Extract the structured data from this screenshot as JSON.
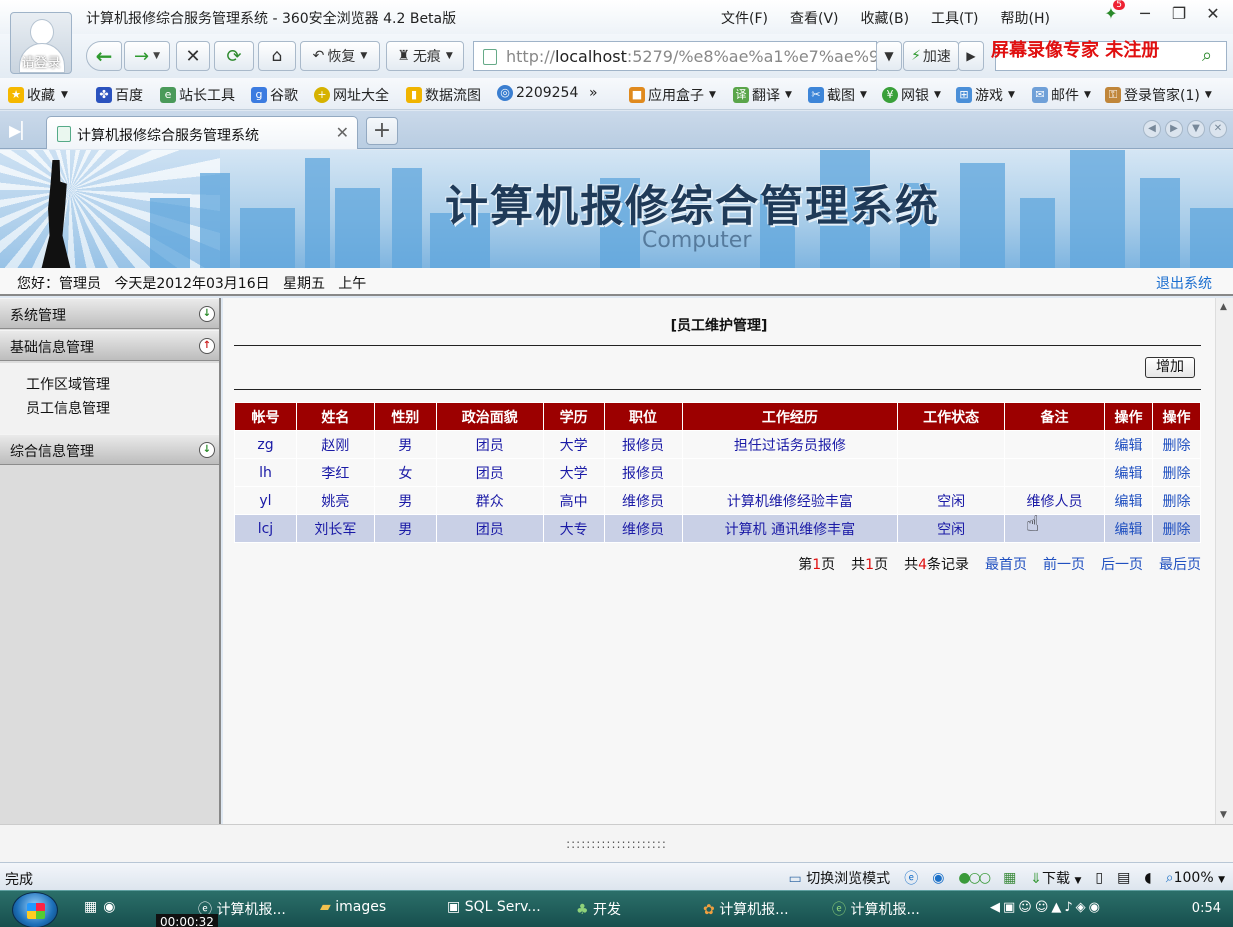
{
  "browser": {
    "window_title": "计算机报修综合服务管理系统 - 360安全浏览器 4.2 Beta版",
    "login_label": "请登录",
    "menus": [
      "文件(F)",
      "查看(V)",
      "收藏(B)",
      "工具(T)",
      "帮助(H)"
    ],
    "notif_count": "5",
    "restore_label": "恢复",
    "nohist_label": "无痕",
    "url_prefix": "http://",
    "url_host": "localhost",
    "url_rest": ":5279/%e8%ae%a1%e7%ae%9",
    "speed_label": "加速",
    "watermark": "屏幕录像专家 未注册",
    "favorites": [
      "收藏",
      "百度",
      "站长工具",
      "谷歌",
      "网址大全",
      "数据流图",
      "2209254",
      "»",
      "应用盒子",
      "翻译",
      "截图",
      "网银",
      "游戏",
      "邮件",
      "登录管家(1)"
    ],
    "tab_title": "计算机报修综合服务管理系统",
    "status_done": "完成",
    "status_mode": "切换浏览模式",
    "status_download": "下载",
    "zoom": "100%"
  },
  "banner": {
    "title": "计算机报修综合管理系统",
    "subtitle": "Computer"
  },
  "welcome": {
    "text": "您好：管理员   今天是2012年03月16日   星期五   上午",
    "logout": "退出系统"
  },
  "sidebar": {
    "sections": [
      {
        "label": "系统管理"
      },
      {
        "label": "基础信息管理"
      },
      {
        "label": "综合信息管理"
      }
    ],
    "items": [
      "工作区域管理",
      "员工信息管理"
    ]
  },
  "main": {
    "title": "[员工维护管理]",
    "add_label": "增加",
    "columns": [
      "帐号",
      "姓名",
      "性别",
      "政治面貌",
      "学历",
      "职位",
      "工作经历",
      "工作状态",
      "备注",
      "操作",
      "操作"
    ],
    "rows": [
      {
        "account": "zg",
        "name": "赵刚",
        "gender": "男",
        "political": "团员",
        "edu": "大学",
        "position": "报修员",
        "experience": "担任过话务员报修",
        "status": "",
        "note": "",
        "edit": "编辑",
        "del": "删除"
      },
      {
        "account": "lh",
        "name": "李红",
        "gender": "女",
        "political": "团员",
        "edu": "大学",
        "position": "报修员",
        "experience": "",
        "status": "",
        "note": "",
        "edit": "编辑",
        "del": "删除"
      },
      {
        "account": "yl",
        "name": "姚亮",
        "gender": "男",
        "political": "群众",
        "edu": "高中",
        "position": "维修员",
        "experience": "计算机维修经验丰富",
        "status": "空闲",
        "note": "维修人员",
        "edit": "编辑",
        "del": "删除"
      },
      {
        "account": "lcj",
        "name": "刘长军",
        "gender": "男",
        "political": "团员",
        "edu": "大专",
        "position": "维修员",
        "experience": "计算机 通讯维修丰富",
        "status": "空闲",
        "note": "",
        "edit": "编辑",
        "del": "删除"
      }
    ],
    "pager": {
      "page_prefix": "第",
      "page_num": "1",
      "page_suffix": "页",
      "total_prefix": "共",
      "total_num": "1",
      "total_suffix": "页",
      "rec_prefix": "共",
      "rec_num": "4",
      "rec_suffix": "条记录",
      "first": "最首页",
      "prev": "前一页",
      "next": "后一页",
      "last": "最后页"
    }
  },
  "taskbar": {
    "timer": "00:00:32",
    "tasks": [
      "计算机报...",
      "images",
      "SQL Serv...",
      "开发",
      "计算机报...",
      "计算机报..."
    ],
    "clock": "0:54"
  }
}
